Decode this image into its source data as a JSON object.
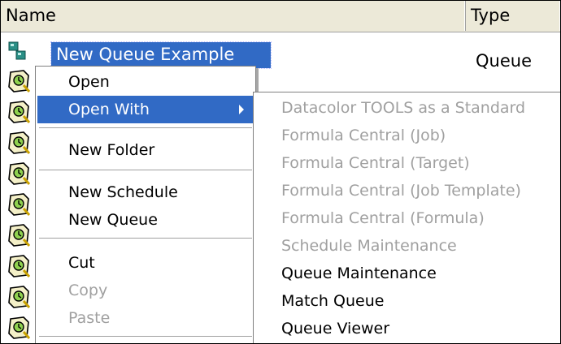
{
  "header": {
    "name": "Name",
    "type": "Type"
  },
  "selected_item": {
    "label": "New Queue Example",
    "type": "Queue"
  },
  "context_menu": {
    "items": [
      {
        "label": "Open",
        "disabled": false
      },
      {
        "label": "Open With",
        "disabled": false,
        "submenu": true
      },
      {
        "label": "New Folder",
        "disabled": false
      },
      {
        "label": "New Schedule",
        "disabled": false
      },
      {
        "label": "New Queue",
        "disabled": false
      },
      {
        "label": "Cut",
        "disabled": false
      },
      {
        "label": "Copy",
        "disabled": true
      },
      {
        "label": "Paste",
        "disabled": true
      }
    ]
  },
  "submenu": {
    "items": [
      {
        "label": "Datacolor TOOLS as a Standard",
        "disabled": true
      },
      {
        "label": "Formula Central (Job)",
        "disabled": true
      },
      {
        "label": "Formula Central (Target)",
        "disabled": true
      },
      {
        "label": "Formula Central (Job Template)",
        "disabled": true
      },
      {
        "label": "Formula Central (Formula)",
        "disabled": true
      },
      {
        "label": "Schedule Maintenance",
        "disabled": true
      },
      {
        "label": "Queue Maintenance",
        "disabled": false
      },
      {
        "label": "Match Queue",
        "disabled": false
      },
      {
        "label": "Queue Viewer",
        "disabled": false
      }
    ]
  },
  "colors": {
    "selection": "#316ac5",
    "disabled_text": "#a0a0a0",
    "header_bg": "#ece9d8"
  },
  "icons": {
    "queue": "queue-icon",
    "schedule": "schedule-icon"
  }
}
